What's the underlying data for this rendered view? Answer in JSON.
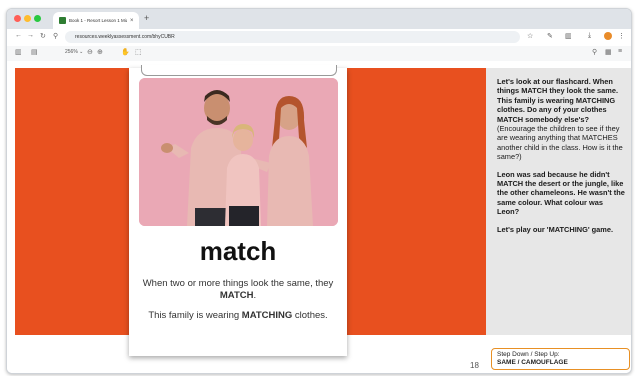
{
  "browser": {
    "tab_title": "Book 1 - Resort Lesson 1 Middle",
    "tab_close": "×",
    "new_tab": "+",
    "url": "resources.weeklyassessment.com/bhyCUBR",
    "zoom": "256% ⌄"
  },
  "icons": {
    "back": "←",
    "forward": "→",
    "reload": "↻",
    "site_info": "⚲",
    "star": "☆",
    "extension": "✎",
    "download": "⤓",
    "menu": "⋮",
    "sidebar": "▥",
    "thumbnail": "▤",
    "zoom_out": "⊖",
    "zoom_in": "⊕",
    "hand": "✋",
    "select": "⬚",
    "search": "⚲",
    "panel": "▦",
    "more": "≡"
  },
  "slide": {
    "word": "match",
    "definition_text": "When two or more things look the same, they ",
    "definition_bold": "MATCH",
    "definition_end": ".",
    "caption_text": "This family is wearing ",
    "caption_bold": "MATCHING",
    "caption_end": " clothes.",
    "page_number": "18"
  },
  "notes": {
    "para1_bold": "Let's look at our flashcard. When things MATCH they look the same. This family is wearing MATCHING clothes. Do any of your clothes MATCH somebody else's?",
    "para1_normal": "(Encourage the children to see if they are wearing anything that MATCHES another child in the class. How is it the same?)",
    "para2_bold": "Leon was sad because he didn't MATCH the desert or the jungle, like the other chameleons. He wasn't the same colour. What colour was Leon?",
    "para3_bold": "Let's play our 'MATCHING' game."
  },
  "step_box": {
    "label": "Step Down / Step Up:",
    "value": "SAME / CAMOUFLAGE"
  },
  "colors": {
    "slide_background": "#e8501f",
    "notes_background": "#e7e7e7",
    "step_border": "#e89024"
  }
}
